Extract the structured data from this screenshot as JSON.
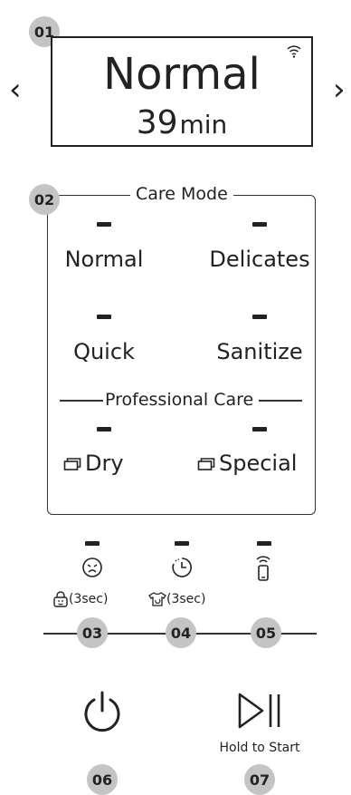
{
  "badges": {
    "b01": "01",
    "b02": "02",
    "b03": "03",
    "b04": "04",
    "b05": "05",
    "b06": "06",
    "b07": "07"
  },
  "display": {
    "mode": "Normal",
    "time_value": "39",
    "time_unit": "min",
    "left_arrow": "‹",
    "right_arrow": "›"
  },
  "care_mode": {
    "title": "Care Mode",
    "options": [
      "Normal",
      "Delicates",
      "Quick",
      "Sanitize"
    ],
    "professional_title": "Professional Care",
    "pro_options": [
      "Dry",
      "Special"
    ]
  },
  "functions": {
    "lock_label": "(3sec)",
    "timer_label": "(3sec)"
  },
  "controls": {
    "hold_to_start": "Hold to Start"
  },
  "icons": [
    "wifi-icon",
    "left-arrow-icon",
    "right-arrow-icon",
    "garment-icon",
    "smart-care-icon",
    "child-lock-icon",
    "delay-timer-icon",
    "shirt-timer-icon",
    "remote-control-icon",
    "power-icon",
    "play-pause-icon"
  ]
}
